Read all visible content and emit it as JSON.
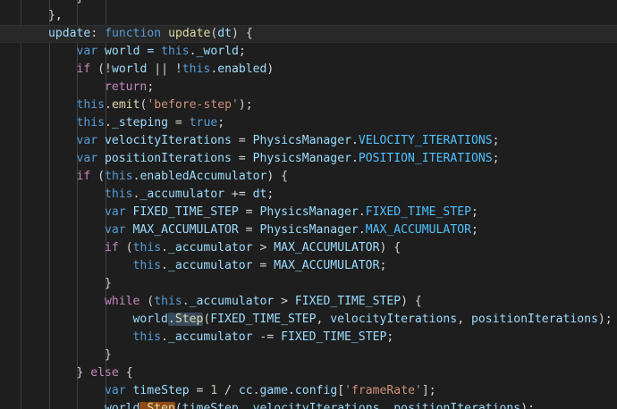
{
  "theme": {
    "kw": "#569cd6",
    "ctrl": "#c586c0",
    "fn": "#dcdcaa",
    "var": "#9cdcfe",
    "cls": "#4ec9b0",
    "const": "#4fc1ff",
    "str": "#ce9178",
    "num": "#b5cea8",
    "plain": "#d4d4d4",
    "background": "#1e1e1e"
  },
  "code": {
    "lines": [
      {
        "indent": 2,
        "tokens": [
          {
            "t": "}",
            "c": "plain"
          }
        ]
      },
      {
        "indent": 1,
        "tokens": [
          {
            "t": "},",
            "c": "plain"
          }
        ]
      },
      {
        "indent": 1,
        "current": true,
        "tokens": [
          {
            "t": "update",
            "c": "var"
          },
          {
            "t": ": ",
            "c": "plain"
          },
          {
            "t": "function",
            "c": "kw"
          },
          {
            "t": " ",
            "c": "plain"
          },
          {
            "t": "update",
            "c": "fn"
          },
          {
            "t": "(",
            "c": "plain"
          },
          {
            "t": "dt",
            "c": "var"
          },
          {
            "t": ") {",
            "c": "plain"
          }
        ]
      },
      {
        "indent": 2,
        "tokens": [
          {
            "t": "var",
            "c": "kw"
          },
          {
            "t": " world = ",
            "c": "var"
          },
          {
            "t": "this",
            "c": "kw"
          },
          {
            "t": ".",
            "c": "plain"
          },
          {
            "t": "_world",
            "c": "var"
          },
          {
            "t": ";",
            "c": "plain"
          }
        ]
      },
      {
        "indent": 2,
        "tokens": [
          {
            "t": "if",
            "c": "ctrl"
          },
          {
            "t": " (!",
            "c": "plain"
          },
          {
            "t": "world",
            "c": "var"
          },
          {
            "t": " || !",
            "c": "plain"
          },
          {
            "t": "this",
            "c": "kw"
          },
          {
            "t": ".",
            "c": "plain"
          },
          {
            "t": "enabled",
            "c": "var"
          },
          {
            "t": ")",
            "c": "plain"
          }
        ]
      },
      {
        "indent": 3,
        "tokens": [
          {
            "t": "return",
            "c": "ctrl"
          },
          {
            "t": ";",
            "c": "plain"
          }
        ]
      },
      {
        "indent": 2,
        "tokens": [
          {
            "t": "this",
            "c": "kw"
          },
          {
            "t": ".",
            "c": "plain"
          },
          {
            "t": "emit",
            "c": "fn"
          },
          {
            "t": "(",
            "c": "plain"
          },
          {
            "t": "'before-step'",
            "c": "str"
          },
          {
            "t": ");",
            "c": "plain"
          }
        ]
      },
      {
        "indent": 2,
        "tokens": [
          {
            "t": "this",
            "c": "kw"
          },
          {
            "t": ".",
            "c": "plain"
          },
          {
            "t": "_steping",
            "c": "var"
          },
          {
            "t": " = ",
            "c": "plain"
          },
          {
            "t": "true",
            "c": "kw"
          },
          {
            "t": ";",
            "c": "plain"
          }
        ]
      },
      {
        "indent": 2,
        "tokens": [
          {
            "t": "var",
            "c": "kw"
          },
          {
            "t": " velocityIterations",
            "c": "var"
          },
          {
            "t": " = ",
            "c": "plain"
          },
          {
            "t": "PhysicsManager",
            "c": "var"
          },
          {
            "t": ".",
            "c": "plain"
          },
          {
            "t": "VELOCITY_ITERATIONS",
            "c": "const"
          },
          {
            "t": ";",
            "c": "plain"
          }
        ]
      },
      {
        "indent": 2,
        "tokens": [
          {
            "t": "var",
            "c": "kw"
          },
          {
            "t": " positionIterations",
            "c": "var"
          },
          {
            "t": " = ",
            "c": "plain"
          },
          {
            "t": "PhysicsManager",
            "c": "var"
          },
          {
            "t": ".",
            "c": "plain"
          },
          {
            "t": "POSITION_ITERATIONS",
            "c": "const"
          },
          {
            "t": ";",
            "c": "plain"
          }
        ]
      },
      {
        "indent": 2,
        "tokens": [
          {
            "t": "if",
            "c": "ctrl"
          },
          {
            "t": " (",
            "c": "plain"
          },
          {
            "t": "this",
            "c": "kw"
          },
          {
            "t": ".",
            "c": "plain"
          },
          {
            "t": "enabledAccumulator",
            "c": "var"
          },
          {
            "t": ") {",
            "c": "plain"
          }
        ]
      },
      {
        "indent": 3,
        "tokens": [
          {
            "t": "this",
            "c": "kw"
          },
          {
            "t": ".",
            "c": "plain"
          },
          {
            "t": "_accumulator",
            "c": "var"
          },
          {
            "t": " += ",
            "c": "plain"
          },
          {
            "t": "dt",
            "c": "var"
          },
          {
            "t": ";",
            "c": "plain"
          }
        ]
      },
      {
        "indent": 3,
        "tokens": [
          {
            "t": "var",
            "c": "kw"
          },
          {
            "t": " FIXED_TIME_STEP",
            "c": "var"
          },
          {
            "t": " = ",
            "c": "plain"
          },
          {
            "t": "PhysicsManager",
            "c": "var"
          },
          {
            "t": ".",
            "c": "plain"
          },
          {
            "t": "FIXED_TIME_STEP",
            "c": "const"
          },
          {
            "t": ";",
            "c": "plain"
          }
        ]
      },
      {
        "indent": 3,
        "tokens": [
          {
            "t": "var",
            "c": "kw"
          },
          {
            "t": " MAX_ACCUMULATOR",
            "c": "var"
          },
          {
            "t": " = ",
            "c": "plain"
          },
          {
            "t": "PhysicsManager",
            "c": "var"
          },
          {
            "t": ".",
            "c": "plain"
          },
          {
            "t": "MAX_ACCUMULATOR",
            "c": "const"
          },
          {
            "t": ";",
            "c": "plain"
          }
        ]
      },
      {
        "indent": 3,
        "tokens": [
          {
            "t": "if",
            "c": "ctrl"
          },
          {
            "t": " (",
            "c": "plain"
          },
          {
            "t": "this",
            "c": "kw"
          },
          {
            "t": ".",
            "c": "plain"
          },
          {
            "t": "_accumulator",
            "c": "var"
          },
          {
            "t": " > ",
            "c": "plain"
          },
          {
            "t": "MAX_ACCUMULATOR",
            "c": "var"
          },
          {
            "t": ") {",
            "c": "plain"
          }
        ]
      },
      {
        "indent": 4,
        "tokens": [
          {
            "t": "this",
            "c": "kw"
          },
          {
            "t": ".",
            "c": "plain"
          },
          {
            "t": "_accumulator",
            "c": "var"
          },
          {
            "t": " = ",
            "c": "plain"
          },
          {
            "t": "MAX_ACCUMULATOR",
            "c": "var"
          },
          {
            "t": ";",
            "c": "plain"
          }
        ]
      },
      {
        "indent": 3,
        "tokens": [
          {
            "t": "}",
            "c": "plain"
          }
        ]
      },
      {
        "indent": 3,
        "tokens": [
          {
            "t": "while",
            "c": "ctrl"
          },
          {
            "t": " (",
            "c": "plain"
          },
          {
            "t": "this",
            "c": "kw"
          },
          {
            "t": ".",
            "c": "plain"
          },
          {
            "t": "_accumulator",
            "c": "var"
          },
          {
            "t": " > ",
            "c": "plain"
          },
          {
            "t": "FIXED_TIME_STEP",
            "c": "var"
          },
          {
            "t": ") {",
            "c": "plain"
          }
        ]
      },
      {
        "indent": 4,
        "tokens": [
          {
            "t": "world",
            "c": "var"
          },
          {
            "t": ".",
            "c": "plain",
            "hl": true
          },
          {
            "t": "Step",
            "c": "fn",
            "hl": true
          },
          {
            "t": "(",
            "c": "plain"
          },
          {
            "t": "FIXED_TIME_STEP",
            "c": "var"
          },
          {
            "t": ", ",
            "c": "plain"
          },
          {
            "t": "velocityIterations",
            "c": "var"
          },
          {
            "t": ", ",
            "c": "plain"
          },
          {
            "t": "positionIterations",
            "c": "var"
          },
          {
            "t": ");",
            "c": "plain"
          }
        ]
      },
      {
        "indent": 4,
        "tokens": [
          {
            "t": "this",
            "c": "kw"
          },
          {
            "t": ".",
            "c": "plain"
          },
          {
            "t": "_accumulator",
            "c": "var"
          },
          {
            "t": " -= ",
            "c": "plain"
          },
          {
            "t": "FIXED_TIME_STEP",
            "c": "var"
          },
          {
            "t": ";",
            "c": "plain"
          }
        ]
      },
      {
        "indent": 3,
        "tokens": [
          {
            "t": "}",
            "c": "plain"
          }
        ]
      },
      {
        "indent": 2,
        "tokens": [
          {
            "t": "} ",
            "c": "plain"
          },
          {
            "t": "else",
            "c": "ctrl"
          },
          {
            "t": " {",
            "c": "plain"
          }
        ]
      },
      {
        "indent": 3,
        "tokens": [
          {
            "t": "var",
            "c": "kw"
          },
          {
            "t": " timeStep",
            "c": "var"
          },
          {
            "t": " = ",
            "c": "plain"
          },
          {
            "t": "1",
            "c": "num"
          },
          {
            "t": " / ",
            "c": "plain"
          },
          {
            "t": "cc",
            "c": "var"
          },
          {
            "t": ".",
            "c": "plain"
          },
          {
            "t": "game",
            "c": "var"
          },
          {
            "t": ".",
            "c": "plain"
          },
          {
            "t": "config",
            "c": "var"
          },
          {
            "t": "[",
            "c": "plain"
          },
          {
            "t": "'frameRate'",
            "c": "str"
          },
          {
            "t": "];",
            "c": "plain"
          }
        ]
      },
      {
        "indent": 3,
        "tokens": [
          {
            "t": "world",
            "c": "var"
          },
          {
            "t": ".",
            "c": "plain",
            "find": true
          },
          {
            "t": "Step",
            "c": "fn",
            "find": true
          },
          {
            "t": "(",
            "c": "plain"
          },
          {
            "t": "timeStep",
            "c": "var"
          },
          {
            "t": ", ",
            "c": "plain"
          },
          {
            "t": "velocityIterations",
            "c": "var"
          },
          {
            "t": ", ",
            "c": "plain"
          },
          {
            "t": "positionIterations",
            "c": "var"
          },
          {
            "t": ");",
            "c": "plain"
          }
        ]
      }
    ]
  }
}
